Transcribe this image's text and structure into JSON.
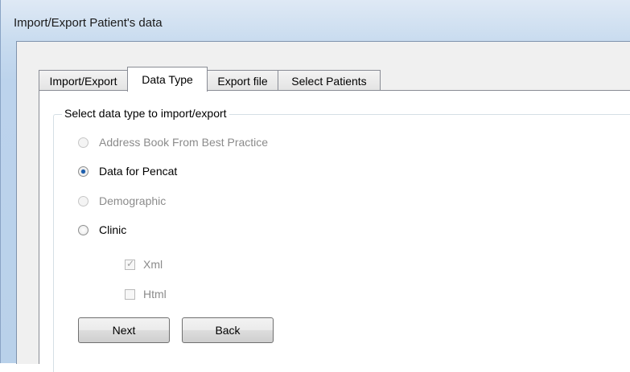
{
  "window": {
    "title": "Import/Export Patient's data"
  },
  "tabs": [
    {
      "label": "Import/Export",
      "active": false
    },
    {
      "label": "Data Type",
      "active": true
    },
    {
      "label": "Export file",
      "active": false
    },
    {
      "label": "Select Patients",
      "active": false
    }
  ],
  "group": {
    "legend": "Select data type to import/export",
    "options": [
      {
        "label": "Address Book From Best Practice",
        "enabled": false,
        "selected": false
      },
      {
        "label": "Data for Pencat",
        "enabled": true,
        "selected": true
      },
      {
        "label": "Demographic",
        "enabled": false,
        "selected": false
      },
      {
        "label": "Clinic",
        "enabled": true,
        "selected": false
      }
    ],
    "formats": [
      {
        "label": "Xml",
        "checked": true,
        "enabled": false
      },
      {
        "label": "Html",
        "checked": false,
        "enabled": false
      }
    ]
  },
  "buttons": {
    "next": "Next",
    "back": "Back"
  },
  "icons": {
    "check_mark": "check-mark-icon"
  }
}
